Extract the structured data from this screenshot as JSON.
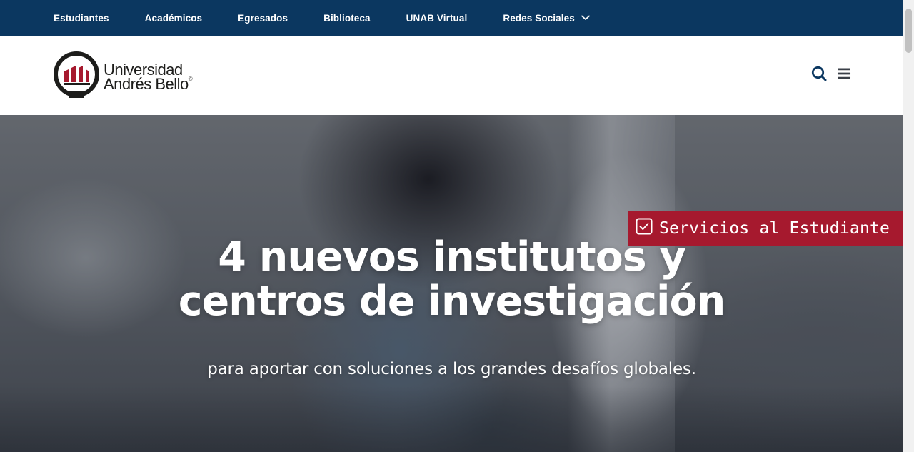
{
  "topnav": {
    "items": [
      {
        "label": "Estudiantes"
      },
      {
        "label": "Académicos"
      },
      {
        "label": "Egresados"
      },
      {
        "label": "Biblioteca"
      },
      {
        "label": "UNAB Virtual"
      },
      {
        "label": "Redes Sociales",
        "has_dropdown": true
      }
    ]
  },
  "header": {
    "logo_line1": "Universidad",
    "logo_line2": "Andrés Bello",
    "logo_reg": "®",
    "icons": [
      "search-icon",
      "menu-icon"
    ]
  },
  "hero": {
    "title_line1": "4 nuevos institutos y",
    "title_line2": "centros de investigación",
    "subtitle": "para aportar con soluciones a los grandes desafíos globales."
  },
  "services_tab": {
    "label": "Servicios al Estudiante",
    "icon": "checkbox-icon"
  },
  "colors": {
    "navy": "#0b3760",
    "brand_red": "#a6192e",
    "white": "#ffffff"
  }
}
